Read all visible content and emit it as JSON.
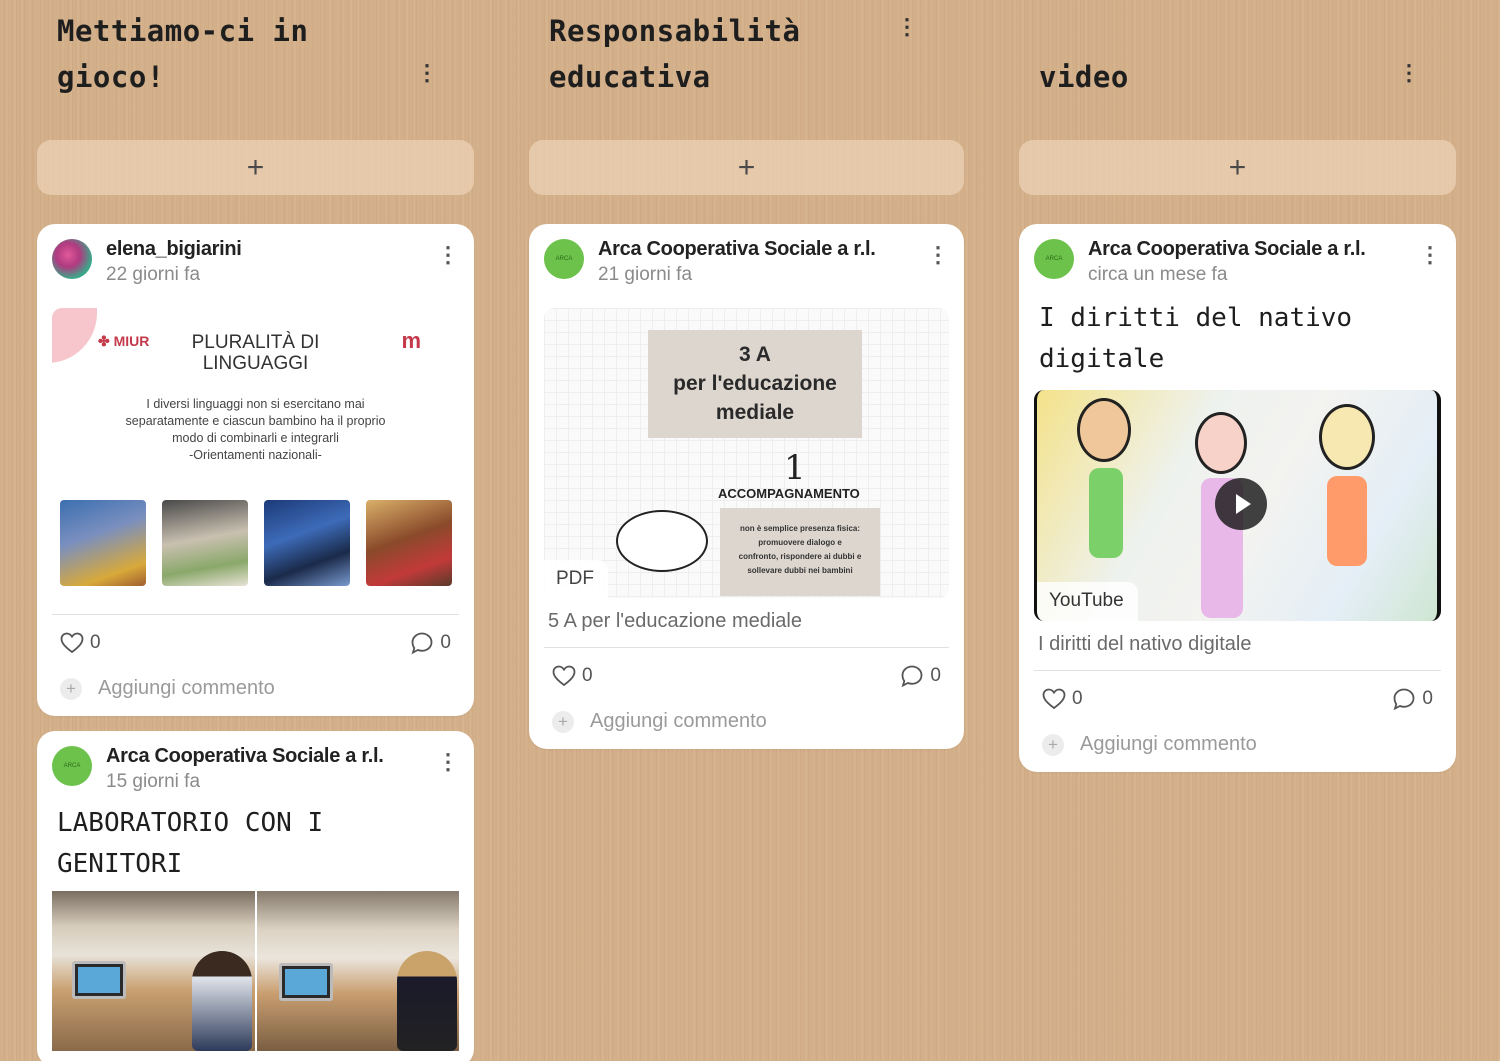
{
  "columns": [
    {
      "title": "Mettiamo-ci in gioco!",
      "add_label": "+",
      "menu_label": "⋮",
      "cards": [
        {
          "author": "elena_bigiarini",
          "time": "22 giorni fa",
          "attachment": {
            "heading_lines": [
              "PLURALITÀ DI",
              "LINGUAGGI"
            ],
            "body_lines": [
              "I diversi linguaggi non si esercitano mai",
              "separatamente e ciascun bambino ha il proprio",
              "modo di combinarli e integrarli",
              "-Orientamenti nazionali-"
            ],
            "logo_left": "✤ MIUR",
            "logo_right": "m"
          },
          "likes": "0",
          "comments": "0",
          "comment_placeholder": "Aggiungi commento"
        },
        {
          "author": "Arca Cooperativa Sociale a r.l.",
          "time": "15 giorni fa",
          "title_lines": [
            "LABORATORIO CON I",
            "GENITORI"
          ]
        }
      ]
    },
    {
      "title_lines": [
        "Responsabilità",
        "educativa"
      ],
      "add_label": "+",
      "menu_label": "⋮",
      "cards": [
        {
          "author": "Arca Cooperativa Sociale a r.l.",
          "time": "21 giorni fa",
          "attachment": {
            "big_lines": [
              "3 A",
              "per l'educazione",
              "mediale"
            ],
            "number": "1",
            "section": "ACCOMPAGNAMENTO",
            "section_lines": [
              "non è semplice presenza fisica:",
              "promuovere dialogo e",
              "confronto, rispondere ai dubbi e",
              "sollevare dubbi nei bambini"
            ],
            "type_label": "PDF"
          },
          "caption": "5 A per l'educazione mediale",
          "likes": "0",
          "comments": "0",
          "comment_placeholder": "Aggiungi commento"
        }
      ]
    },
    {
      "title": "video",
      "add_label": "+",
      "menu_label": "⋮",
      "cards": [
        {
          "author": "Arca Cooperativa Sociale a r.l.",
          "time": "circa un mese fa",
          "title": "I diritti del nativo digitale",
          "attachment": {
            "type_label": "YouTube"
          },
          "caption": "I diritti del nativo digitale",
          "likes": "0",
          "comments": "0",
          "comment_placeholder": "Aggiungi commento"
        }
      ]
    }
  ],
  "icons": {
    "column_menu": "kebab-menu-icon",
    "card_menu": "kebab-menu-icon",
    "like": "heart-icon",
    "comment": "comment-bubble-icon",
    "add_comment": "plus-circle-icon",
    "play": "play-icon"
  },
  "colors": {
    "background": "#d4b08a",
    "card": "#ffffff",
    "avatar_green": "#6cc24a",
    "add_button": "#ebd2b4"
  }
}
